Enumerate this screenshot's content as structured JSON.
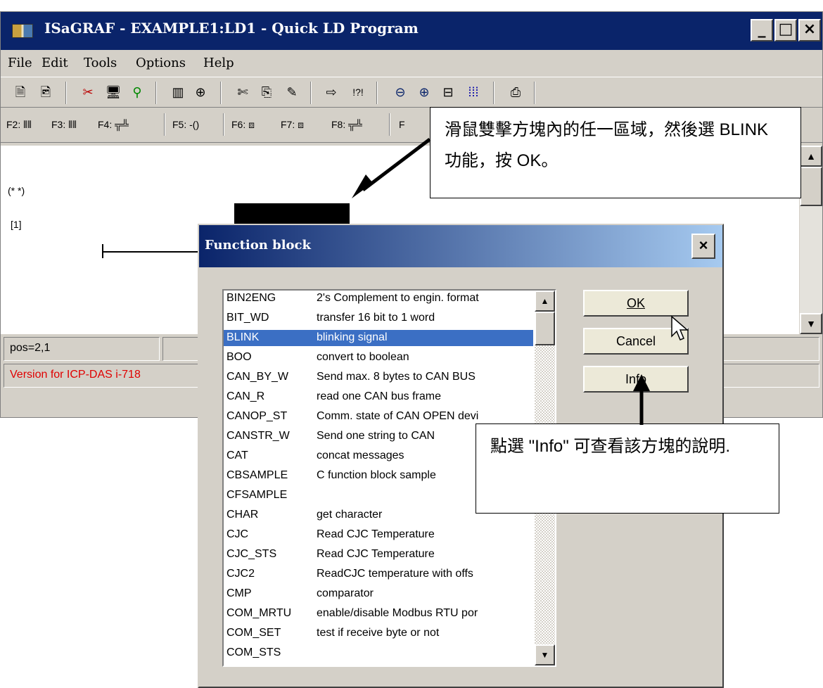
{
  "window": {
    "title": "ISaGRAF - EXAMPLE1:LD1 - Quick LD Program",
    "controls": {
      "minimize": "_",
      "maximize": "□",
      "close": "×"
    }
  },
  "menu": [
    "File",
    "Edit",
    "Tools",
    "Options",
    "Help"
  ],
  "toolbar1_icons": [
    "new-file-icon",
    "open-file-icon",
    "cut-icon",
    "monitor-icon",
    "connect-icon",
    "library-icon",
    "variables-icon",
    "scissors-icon",
    "copy-icon",
    "paste-icon",
    "goto-icon",
    "find-icon",
    "zoom-out-icon",
    "zoom-in-icon",
    "fit-icon",
    "grid-icon",
    "print-icon"
  ],
  "toolbar2": [
    "F2:",
    "F3:",
    "F4:",
    "F5:",
    "F6:",
    "F7:",
    "F8:",
    "F"
  ],
  "editor": {
    "comment": "(* *)",
    "rung": "[1]"
  },
  "status": {
    "position": "pos=2,1",
    "version": "Version for ICP-DAS i-718"
  },
  "dialog": {
    "title": "Function block",
    "close": "×",
    "ok": "OK",
    "cancel": "Cancel",
    "info": "Info",
    "selected": "BLINK",
    "items": [
      {
        "name": "BIN2ENG",
        "desc": "2's Complement to engin. format"
      },
      {
        "name": "BIT_WD",
        "desc": "transfer 16 bit to 1 word"
      },
      {
        "name": "BLINK",
        "desc": "blinking signal"
      },
      {
        "name": "BOO",
        "desc": "convert to boolean"
      },
      {
        "name": "CAN_BY_W",
        "desc": "Send max. 8 bytes to CAN BUS"
      },
      {
        "name": "CAN_R",
        "desc": "read one CAN bus frame"
      },
      {
        "name": "CANOP_ST",
        "desc": "Comm. state of CAN OPEN devi"
      },
      {
        "name": "CANSTR_W",
        "desc": "Send one string to CAN"
      },
      {
        "name": "CAT",
        "desc": "concat messages"
      },
      {
        "name": "CBSAMPLE",
        "desc": "C function block sample"
      },
      {
        "name": "CFSAMPLE",
        "desc": ""
      },
      {
        "name": "CHAR",
        "desc": "get character"
      },
      {
        "name": "CJC",
        "desc": "Read CJC Temperature"
      },
      {
        "name": "CJC_STS",
        "desc": "Read CJC Temperature"
      },
      {
        "name": "CJC2",
        "desc": "ReadCJC temperature with offs"
      },
      {
        "name": "CMP",
        "desc": "comparator"
      },
      {
        "name": "COM_MRTU",
        "desc": "enable/disable Modbus RTU por"
      },
      {
        "name": "COM_SET",
        "desc": "test if receive byte or not"
      },
      {
        "name": "COM_STS",
        "desc": ""
      }
    ]
  },
  "callouts": {
    "top": "滑鼠雙擊方塊內的任一區域，然後選 BLINK 功能，按 OK。",
    "bottom": "點選 \"Info\" 可查看該方塊的說明."
  }
}
